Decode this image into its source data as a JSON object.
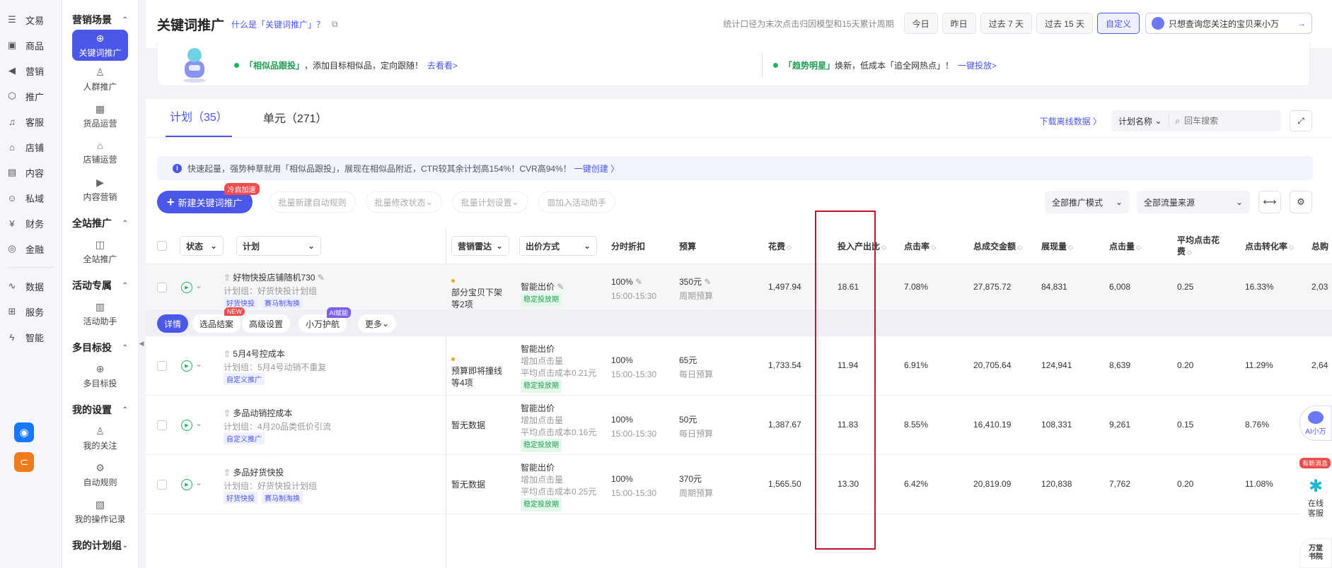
{
  "rail": {
    "items": [
      {
        "label": "文易",
        "icon": "doc-icon"
      },
      {
        "label": "商品",
        "icon": "bag-icon"
      },
      {
        "label": "营销",
        "icon": "megaphone-icon"
      },
      {
        "label": "推广",
        "icon": "shield-icon"
      },
      {
        "label": "客服",
        "icon": "headset-icon"
      },
      {
        "label": "店铺",
        "icon": "store-icon"
      },
      {
        "label": "内容",
        "icon": "content-icon"
      },
      {
        "label": "私域",
        "icon": "people-icon"
      },
      {
        "label": "财务",
        "icon": "yen-icon"
      },
      {
        "label": "金融",
        "icon": "coin-icon"
      }
    ],
    "items2": [
      {
        "label": "数据",
        "icon": "chart-icon"
      },
      {
        "label": "服务",
        "icon": "grid-icon"
      },
      {
        "label": "智能",
        "icon": "bolt-icon"
      }
    ]
  },
  "sidebar": {
    "groups": [
      {
        "title": "营销场景",
        "items": [
          {
            "label": "关键词推广",
            "icon": "target-icon",
            "active": true
          },
          {
            "label": "人群推广",
            "icon": "person-icon"
          },
          {
            "label": "货品运营",
            "icon": "goods-icon"
          },
          {
            "label": "店铺运营",
            "icon": "shop-icon"
          },
          {
            "label": "内容营销",
            "icon": "play-icon"
          }
        ]
      },
      {
        "title": "全站推广",
        "items": [
          {
            "label": "全站推广",
            "icon": "camera-icon"
          }
        ]
      },
      {
        "title": "活动专属",
        "items": [
          {
            "label": "活动助手",
            "icon": "calendar-icon"
          }
        ]
      },
      {
        "title": "多目标投",
        "items": [
          {
            "label": "多目标投",
            "icon": "target-icon"
          }
        ]
      },
      {
        "title": "我的设置",
        "items": [
          {
            "label": "我的关注",
            "icon": "person-icon"
          },
          {
            "label": "自动规则",
            "icon": "gear-icon"
          },
          {
            "label": "我的操作记录",
            "icon": "record-icon"
          }
        ]
      },
      {
        "title": "我的计划组",
        "items": []
      }
    ]
  },
  "header": {
    "title": "关键词推广",
    "help_link": "什么是「关键词推广」？",
    "note": "统计口径为末次点击归因模型和15天累计周期",
    "date_buttons": [
      "今日",
      "昨日",
      "过去 7 天",
      "过去 15 天",
      "自定义"
    ],
    "ai_query": "只想查询您关注的宝贝来小万"
  },
  "banner": {
    "left": {
      "highlight": "「相似品跟投」",
      "text": "，添加目标相似品，定向跟随！",
      "link": "去看看>"
    },
    "right": {
      "highlight": "「趋势明星」",
      "text": "焕新，低成本「追全网热点」！",
      "link": "一键投放>"
    }
  },
  "tabs": [
    {
      "label": "计划（35）",
      "active": true
    },
    {
      "label": "单元（271）",
      "active": false
    }
  ],
  "toolbar": {
    "download": "下载离线数据",
    "search_field": "计划名称",
    "search_placeholder": "回车搜索"
  },
  "notice": {
    "text": "快速起量，强势种草就用「相似品跟投」，展现在相似品附近，CTR较其余计划高154%！CVR高94%！",
    "link": "一键创建"
  },
  "actions": {
    "new_button": "新建关键词推广",
    "new_badge": "冷启加速",
    "batch": [
      "批量新建自动规则",
      "批量修改状态",
      "批量计划设置",
      "加入活动助手"
    ],
    "mode_select": "全部推广模式",
    "traffic_select": "全部流量来源"
  },
  "table": {
    "headers": {
      "status": "状态",
      "plan": "计划",
      "radar": "营销雷达",
      "bid": "出价方式",
      "discount": "分时折扣",
      "budget": "预算",
      "spend": "花费",
      "roi": "投入产出比",
      "ctr": "点击率",
      "gmv": "总成交金额",
      "impressions": "展现量",
      "clicks": "点击量",
      "cpc": "平均点击花费",
      "cvr": "点击转化率",
      "last": "总购"
    },
    "sub_row": {
      "buttons": [
        "详情",
        "选品结案",
        "高级设置",
        "小万护航",
        "更多"
      ],
      "badge_new": "NEW",
      "badge_ai": "AI赋能"
    },
    "rows": [
      {
        "name": "好物快投店铺随机730",
        "group": "计划组：好货快投计划组",
        "tags": [
          "好货快投",
          "赛马制淘换"
        ],
        "radar": [
          "部分宝贝下架",
          "等2项"
        ],
        "bid": "智能出价",
        "bid_lines": [],
        "bid_tag": "稳定投放期",
        "discount": "100%",
        "time": "15:00-15:30",
        "budget": "350元",
        "budget_type": "周期预算",
        "spend": "1,497.94",
        "roi": "18.61",
        "ctr": "7.08%",
        "gmv": "27,875.72",
        "impressions": "84,831",
        "clicks": "6,008",
        "cpc": "0.25",
        "cvr": "16.33%",
        "last": "2,03"
      },
      {
        "name": "5月4号控成本",
        "group": "计划组：5月4号动销不重复",
        "tags": [
          "自定义推广"
        ],
        "radar": [
          "预算即将撞线",
          "等4项"
        ],
        "bid": "智能出价",
        "bid_lines": [
          "增加点击量",
          "平均点击成本0.21元"
        ],
        "bid_tag": "稳定投放期",
        "discount": "100%",
        "time": "15:00-15:30",
        "budget": "65元",
        "budget_type": "每日预算",
        "spend": "1,733.54",
        "roi": "11.94",
        "ctr": "6.91%",
        "gmv": "20,705.64",
        "impressions": "124,941",
        "clicks": "8,639",
        "cpc": "0.20",
        "cvr": "11.29%",
        "last": "2,64"
      },
      {
        "name": "多品动销控成本",
        "group": "计划组：4月20品类低价引流",
        "tags": [
          "自定义推广"
        ],
        "radar": [
          "暂无数据"
        ],
        "bid": "智能出价",
        "bid_lines": [
          "增加点击量",
          "平均点击成本0.16元"
        ],
        "bid_tag": "稳定投放期",
        "discount": "100%",
        "time": "15:00-15:30",
        "budget": "50元",
        "budget_type": "每日预算",
        "spend": "1,387.67",
        "roi": "11.83",
        "ctr": "8.55%",
        "gmv": "16,410.19",
        "impressions": "108,331",
        "clicks": "9,261",
        "cpc": "0.15",
        "cvr": "8.76%",
        "last": ""
      },
      {
        "name": "多品好货快投",
        "group": "计划组：好货快投计划组",
        "tags": [
          "好货快投",
          "赛马制淘换"
        ],
        "radar": [
          "暂无数据"
        ],
        "bid": "智能出价",
        "bid_lines": [
          "增加点击量",
          "平均点击成本0.25元"
        ],
        "bid_tag": "稳定投放期",
        "discount": "100%",
        "time": "15:00-15:30",
        "budget": "370元",
        "budget_type": "周期预算",
        "spend": "1,565.50",
        "roi": "13.30",
        "ctr": "6.42%",
        "gmv": "20,819.09",
        "impressions": "120,838",
        "clicks": "7,762",
        "cpc": "0.20",
        "cvr": "11.08%",
        "last": ""
      }
    ]
  },
  "float": {
    "ai": "AI小万",
    "cs_badge": "有新消息",
    "cs": "在线客服",
    "book": "万堂书院"
  },
  "colors": {
    "accent": "#4b57e8",
    "green": "#22b35e",
    "highlight_box": "#c8102e"
  }
}
